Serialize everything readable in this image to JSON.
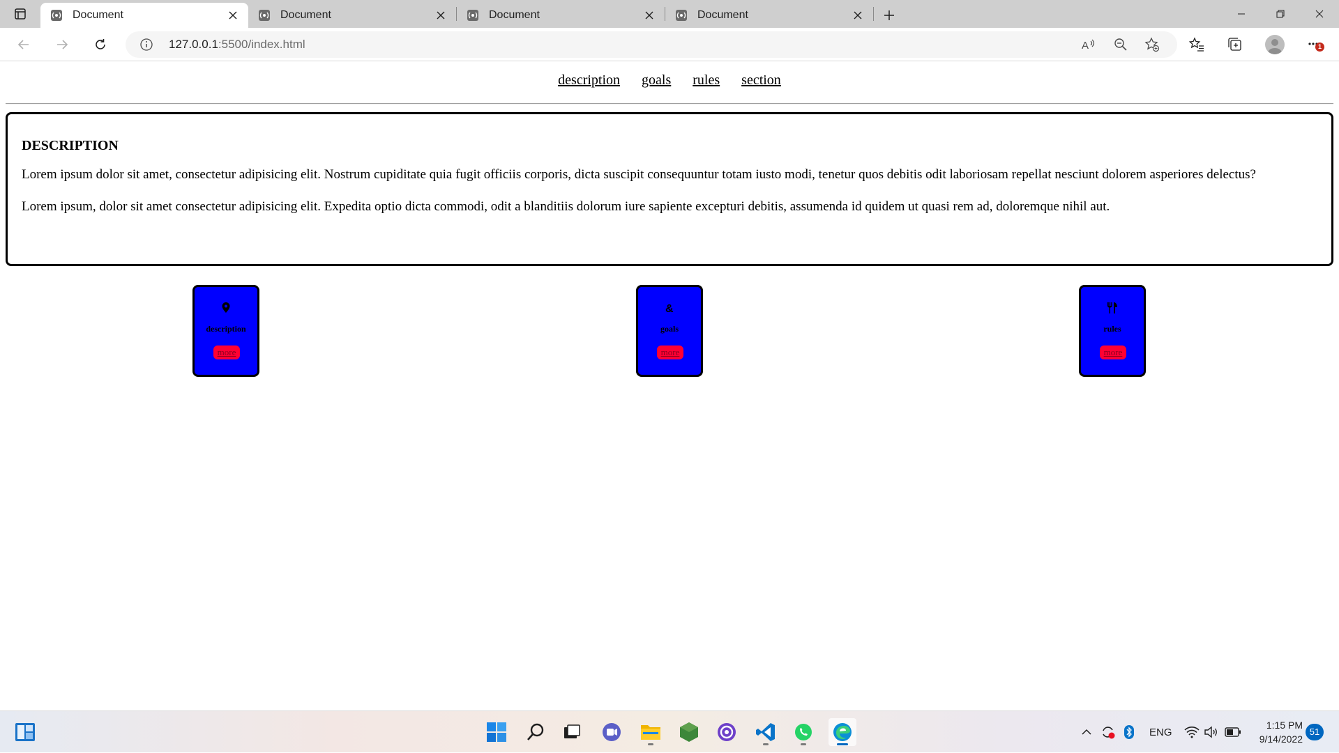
{
  "browser": {
    "tabs": [
      {
        "title": "Document",
        "active": true
      },
      {
        "title": "Document",
        "active": false
      },
      {
        "title": "Document",
        "active": false
      },
      {
        "title": "Document",
        "active": false
      }
    ],
    "address": {
      "host": "127.0.0.1",
      "path": ":5500/index.html"
    },
    "notification_count": "1"
  },
  "page": {
    "nav": [
      "description",
      "goals",
      "rules",
      "section"
    ],
    "description": {
      "heading": "DESCRIPTION",
      "paragraphs": [
        "Lorem ipsum dolor sit amet, consectetur adipisicing elit. Nostrum cupiditate quia fugit officiis corporis, dicta suscipit consequuntur totam iusto modi, tenetur quos debitis odit laboriosam repellat nesciunt dolorem asperiores delectus?",
        "Lorem ipsum, dolor sit amet consectetur adipisicing elit. Expedita optio dicta commodi, odit a blanditiis dolorum iure sapiente excepturi debitis, assumenda id quidem ut quasi rem ad, doloremque nihil aut."
      ]
    },
    "cards": [
      {
        "label": "description",
        "icon": "map-pin-icon",
        "more": "more"
      },
      {
        "label": "goals",
        "icon": "ampersand-icon",
        "more": "more"
      },
      {
        "label": "rules",
        "icon": "utensils-icon",
        "more": "more"
      }
    ],
    "colors": {
      "card_bg": "#0000ff",
      "more_bg": "#ff0033"
    }
  },
  "taskbar": {
    "language": "ENG",
    "time": "1:15 PM",
    "date": "9/14/2022",
    "notification_count": "51"
  }
}
